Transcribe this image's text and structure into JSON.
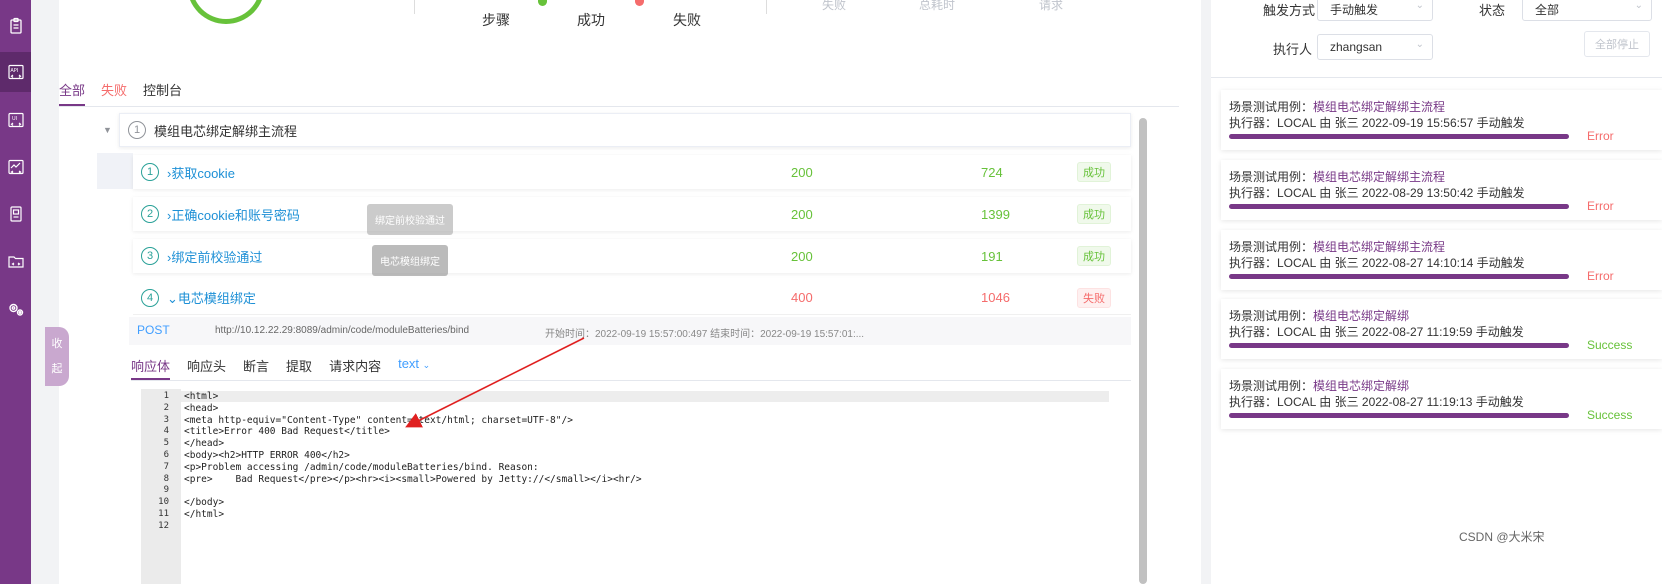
{
  "summary": {
    "steps_label": "步骤",
    "success_label": "成功",
    "fail_label": "失败",
    "faded_1": "失败",
    "faded_2": "总耗时",
    "faded_3": "请求"
  },
  "colors": {
    "brand": "#783887",
    "success": "#67c23a",
    "error": "#f56c6c",
    "link": "#1e90d6"
  },
  "tabs": {
    "all": "全部",
    "fail": "失败",
    "console": "控制台"
  },
  "collapse_label": [
    "收",
    "起"
  ],
  "scenario": {
    "index": "1",
    "name": "模组电芯绑定解绑主流程"
  },
  "steps": [
    {
      "index": "1",
      "name": "获取cookie",
      "code": "200",
      "time": "724",
      "status": "成功"
    },
    {
      "index": "2",
      "name": "正确cookie和账号密码",
      "code": "200",
      "time": "1399",
      "status": "成功"
    },
    {
      "index": "3",
      "name": "绑定前校验通过",
      "code": "200",
      "time": "191",
      "status": "成功"
    },
    {
      "index": "4",
      "name": "电芯模组绑定",
      "code": "400",
      "time": "1046",
      "status": "失败"
    }
  ],
  "tooltips": {
    "t1": "绑定前校验通过",
    "t2": "电芯模组绑定"
  },
  "request": {
    "method": "POST",
    "url": "http://10.12.22.29:8089/admin/code/moduleBatteries/bind",
    "times": "开始时间：2022-09-19 15:57:00:497 结束时间：2022-09-19 15:57:01:..."
  },
  "response_tabs": {
    "body": "响应体",
    "header": "响应头",
    "assert": "断言",
    "extract": "提取",
    "request": "请求内容",
    "format": "text"
  },
  "code_lines": [
    "<html>",
    "<head>",
    "<meta http-equiv=\"Content-Type\" content=\"text/html; charset=UTF-8\"/>",
    "<title>Error 400 Bad Request</title>",
    "</head>",
    "<body><h2>HTTP ERROR 400</h2>",
    "<p>Problem accessing /admin/code/moduleBatteries/bind. Reason:",
    "<pre>    Bad Request</pre></p><hr><i><small>Powered by Jetty://</small></i><hr/>",
    "",
    "</body>",
    "</html>",
    ""
  ],
  "filters": {
    "trigger_label": "触发方式",
    "trigger_value": "手动触发",
    "status_label": "状态",
    "status_value": "全部",
    "executor_label": "执行人",
    "executor_value": "zhangsan",
    "stop_all": "全部停止"
  },
  "history": [
    {
      "prefix": "场景测试用例：",
      "case": "模组电芯绑定解绑主流程",
      "detail": "执行器：LOCAL 由 张三 2022-09-19 15:56:57 手动触发",
      "status": "Error"
    },
    {
      "prefix": "场景测试用例：",
      "case": "模组电芯绑定解绑主流程",
      "detail": "执行器：LOCAL 由 张三 2022-08-29 13:50:42 手动触发",
      "status": "Error"
    },
    {
      "prefix": "场景测试用例：",
      "case": "模组电芯绑定解绑主流程",
      "detail": "执行器：LOCAL 由 张三 2022-08-27 14:10:14 手动触发",
      "status": "Error"
    },
    {
      "prefix": "场景测试用例：",
      "case": "模组电芯绑定解绑",
      "detail": "执行器：LOCAL 由 张三 2022-08-27 11:19:59 手动触发",
      "status": "Success"
    },
    {
      "prefix": "场景测试用例：",
      "case": "模组电芯绑定解绑",
      "detail": "执行器：LOCAL 由 张三 2022-08-27 11:19:13 手动触发",
      "status": "Success"
    }
  ],
  "watermark": "CSDN @大米宋"
}
